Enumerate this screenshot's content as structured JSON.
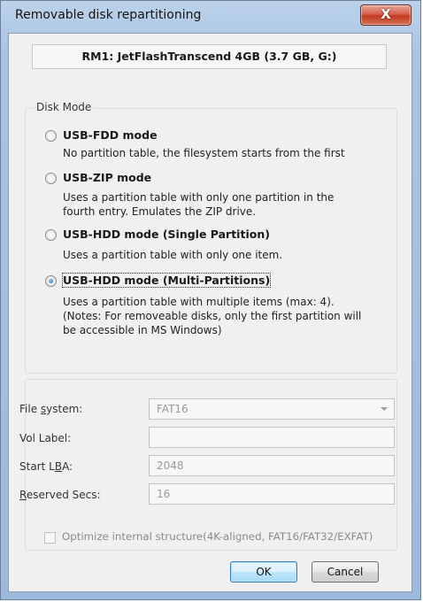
{
  "window": {
    "title": "Removable disk repartitioning",
    "close_glyph": "X"
  },
  "device": {
    "label": "RM1: JetFlashTranscend 4GB (3.7 GB, G:)"
  },
  "disk_mode": {
    "group_label": "Disk Mode",
    "selected": "usb-hdd-multi",
    "options": [
      {
        "label": "USB-FDD mode",
        "desc": [
          "No partition table, the filesystem starts from the first"
        ]
      },
      {
        "label": "USB-ZIP mode",
        "desc": [
          "Uses a partition table with only one partition in the",
          "fourth entry. Emulates the ZIP drive."
        ]
      },
      {
        "label": "USB-HDD mode (Single Partition)",
        "desc": [
          "Uses a partition table with only one item."
        ]
      },
      {
        "label": "USB-HDD mode (Multi-Partitions)",
        "desc": [
          "Uses a partition table with multiple items (max: 4).",
          "(Notes: For removeable disks, only the first partition will",
          "be accessible in MS Windows)"
        ]
      }
    ]
  },
  "fields": {
    "file_system": {
      "label_pre": "File ",
      "label_key": "s",
      "label_post": "ystem:",
      "value": "FAT16"
    },
    "vol_label": {
      "label": "Vol Label:",
      "value": ""
    },
    "start_lba": {
      "label_pre": "Start L",
      "label_key": "B",
      "label_post": "A:",
      "value": "2048"
    },
    "reserved_secs": {
      "label_pre": "",
      "label_key": "R",
      "label_post": "eserved Secs:",
      "value": "16"
    }
  },
  "optimize": {
    "label": "Optimize internal structure(4K-aligned, FAT16/FAT32/EXFAT)",
    "checked": false
  },
  "buttons": {
    "ok": "OK",
    "cancel": "Cancel"
  }
}
